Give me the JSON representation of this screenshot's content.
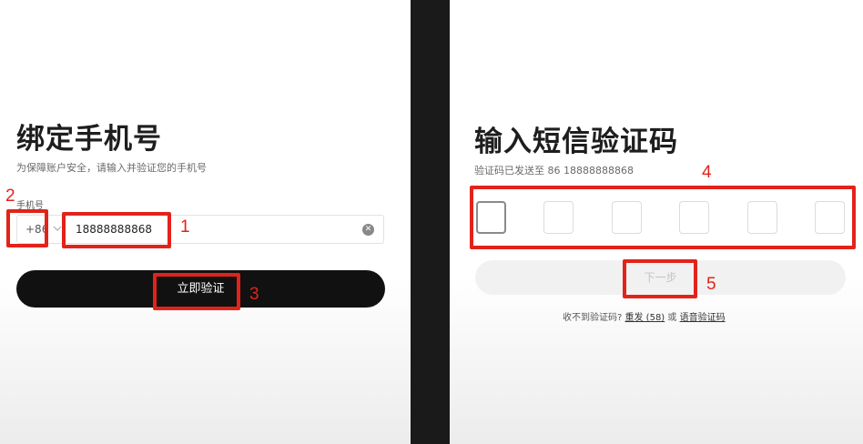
{
  "left": {
    "title": "绑定手机号",
    "subtitle": "为保障账户安全，请输入并验证您的手机号",
    "phone_label": "手机号",
    "country_code": "+86",
    "phone_value": "18888888868",
    "clear_icon": "clear-circle-icon",
    "verify_button": "立即验证"
  },
  "right": {
    "title": "输入短信验证码",
    "subtitle": "验证码已发送至 86 18888888868",
    "code_boxes": [
      "",
      "",
      "",
      "",
      "",
      ""
    ],
    "next_button": "下一步",
    "footer": {
      "prefix": "收不到验证码?",
      "resend": "重发 (58)",
      "or": "或",
      "voice": "语音验证码"
    }
  },
  "annotations": {
    "color": "#e2231a",
    "labels": [
      "1",
      "2",
      "3",
      "4",
      "5"
    ]
  },
  "colors": {
    "primary_button": "#111111",
    "disabled_button": "#f1f1f1",
    "divider": "#1a1a1a"
  }
}
